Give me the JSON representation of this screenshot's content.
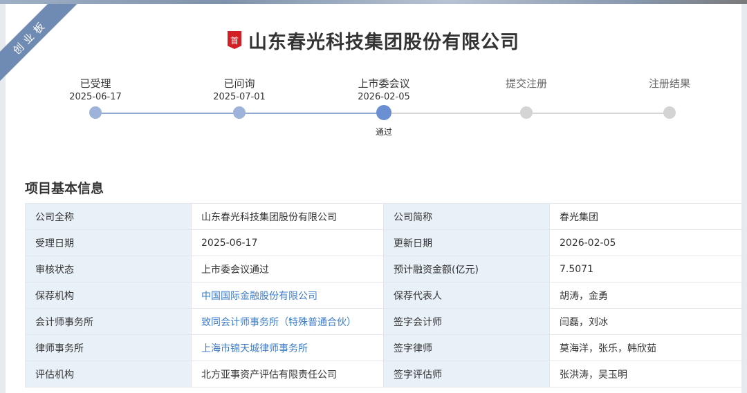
{
  "ribbon": {
    "text": "创业板"
  },
  "header": {
    "badge": "首",
    "title": "山东春光科技集团股份有限公司"
  },
  "timeline": {
    "steps": [
      {
        "label": "已受理",
        "date": "2025-06-17",
        "state": "done"
      },
      {
        "label": "已问询",
        "date": "2025-07-01",
        "state": "done"
      },
      {
        "label": "上市委会议",
        "date": "2026-02-05",
        "state": "current",
        "result": "通过"
      },
      {
        "label": "提交注册",
        "date": "",
        "state": "pending"
      },
      {
        "label": "注册结果",
        "date": "",
        "state": "pending"
      }
    ]
  },
  "section": {
    "title": "项目基本信息"
  },
  "info": {
    "rows": [
      {
        "l1": "公司全称",
        "v1": "山东春光科技集团股份有限公司",
        "l2": "公司简称",
        "v2": "春光集团"
      },
      {
        "l1": "受理日期",
        "v1": "2025-06-17",
        "l2": "更新日期",
        "v2": "2026-02-05"
      },
      {
        "l1": "审核状态",
        "v1": "上市委会议通过",
        "l2": "预计融资金额(亿元)",
        "v2": "7.5071"
      },
      {
        "l1": "保荐机构",
        "v1": "中国国际金融股份有限公司",
        "l2": "保荐代表人",
        "v2": "胡涛，金勇"
      },
      {
        "l1": "会计师事务所",
        "v1": "致同会计师事务所（特殊普通合伙）",
        "l2": "签字会计师",
        "v2": "闫磊，刘冰"
      },
      {
        "l1": "律师事务所",
        "v1": "上海市锦天城律师事务所",
        "l2": "签字律师",
        "v2": "莫海洋，张乐，韩欣茹"
      },
      {
        "l1": "评估机构",
        "v1": "北方亚事资产评估有限责任公司",
        "l2": "签字评估师",
        "v2": "张洪涛，吴玉明"
      }
    ]
  },
  "colors": {
    "accent": "#6b8fd3",
    "done_dot": "#9db3d9",
    "pending_dot": "#d4d4d4",
    "link": "#3d7cc9",
    "label_bg": "#e8f0f8",
    "ribbon": "#6f8ab3",
    "badge": "#d21f25"
  }
}
